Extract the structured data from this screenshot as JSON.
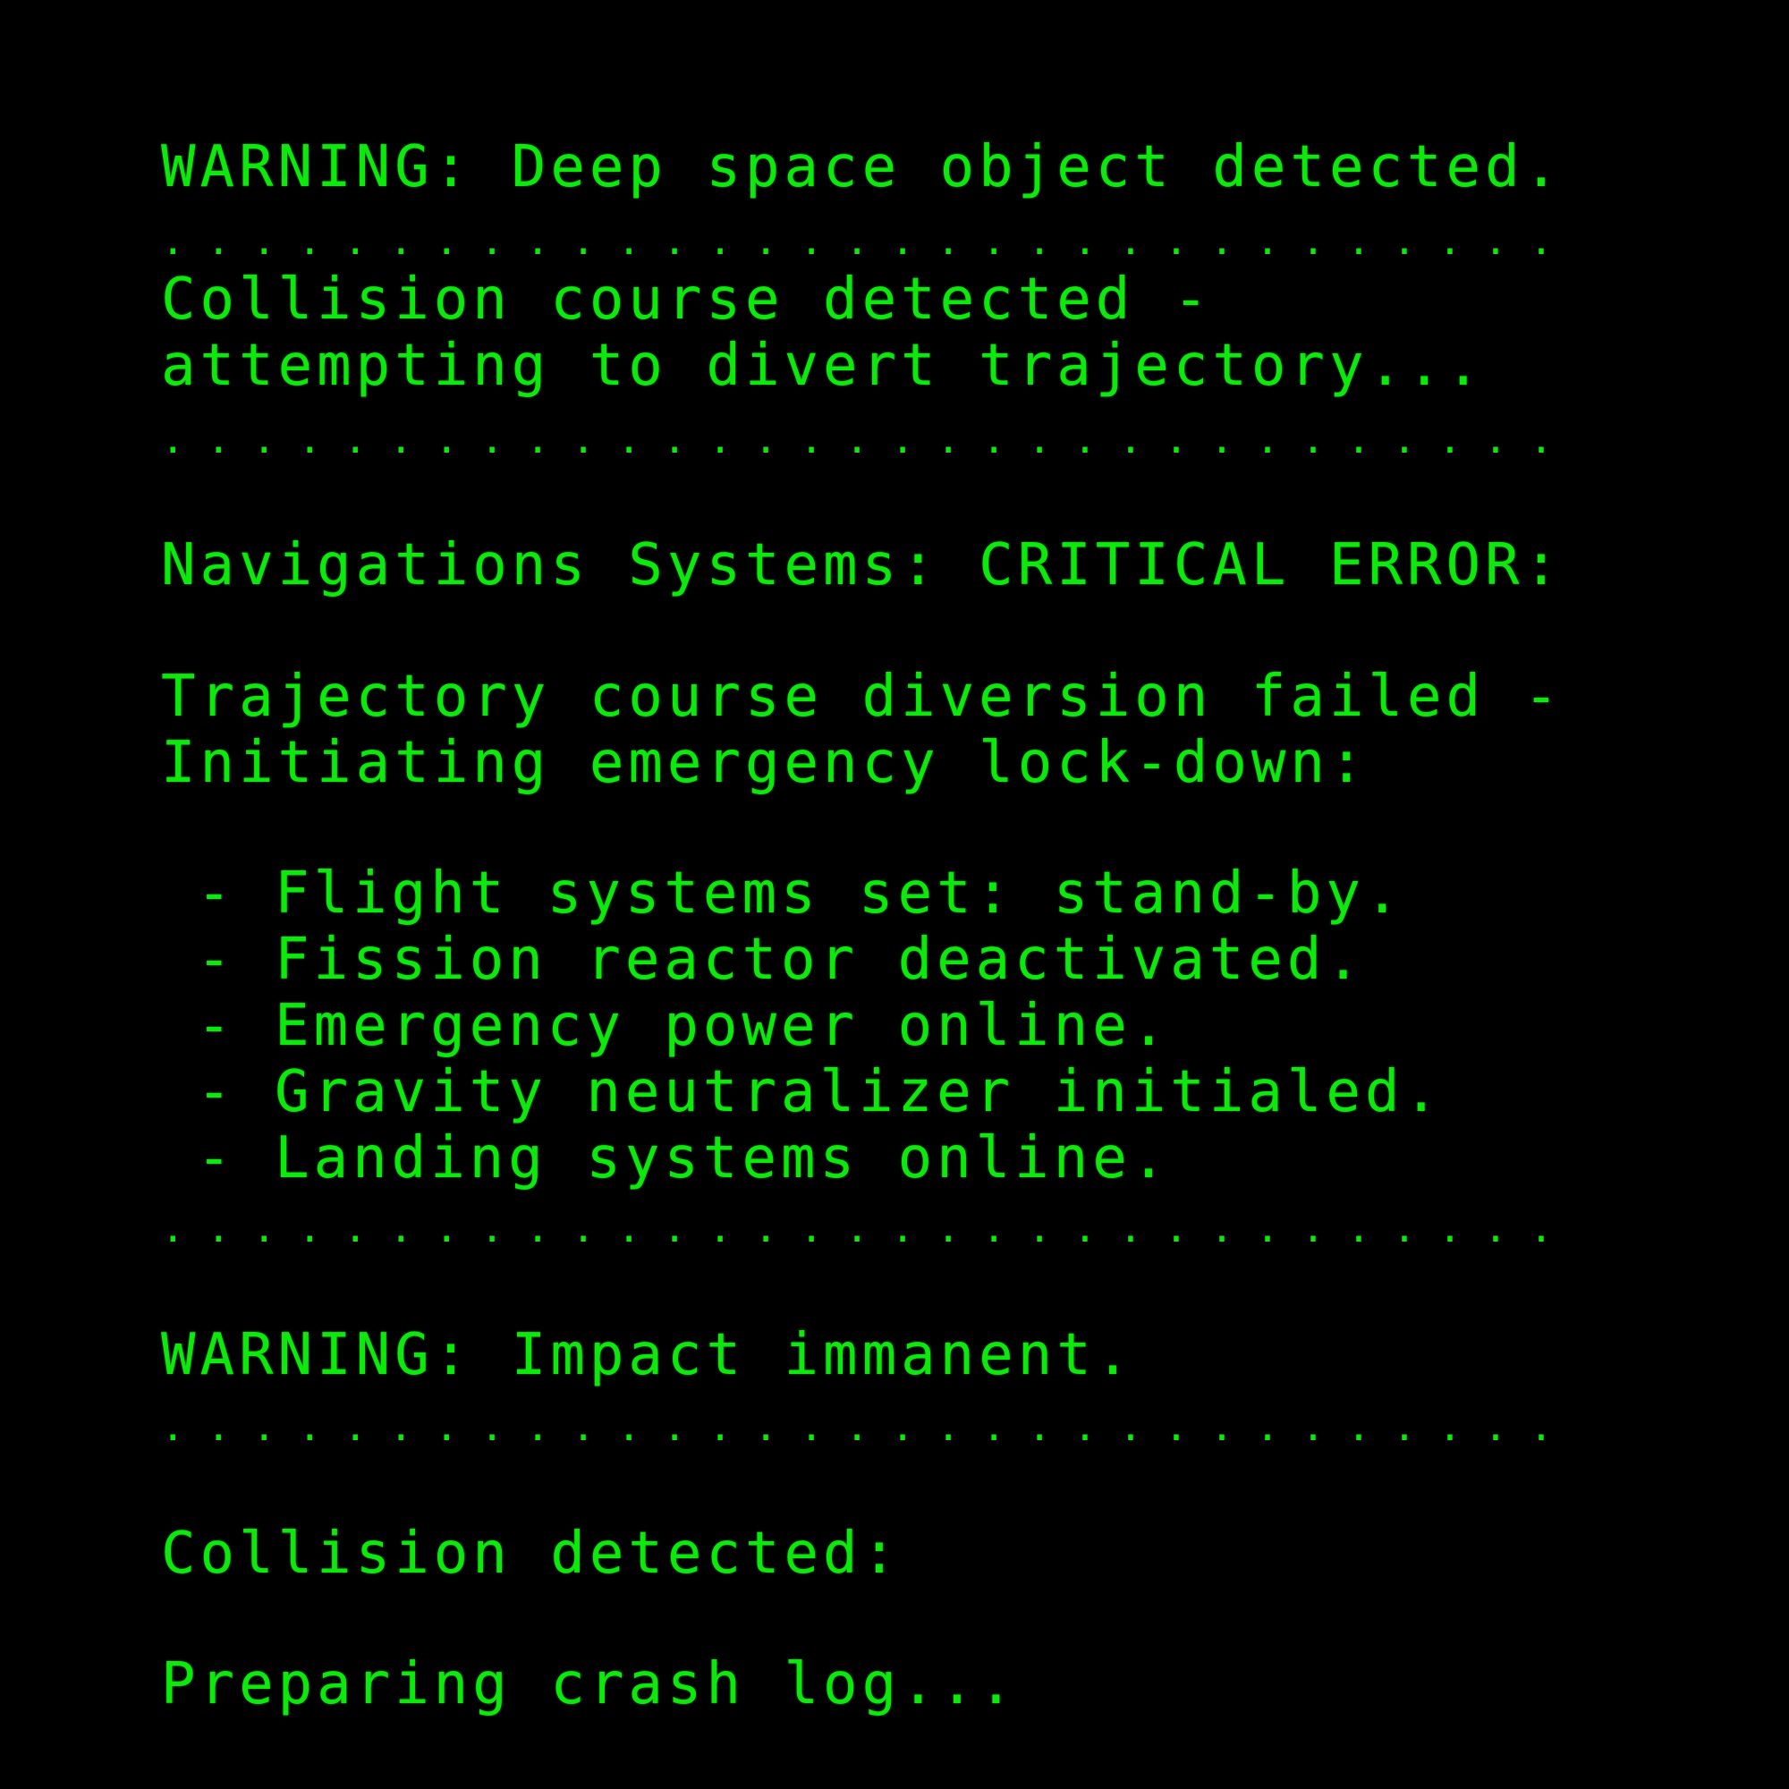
{
  "theme": {
    "background": "#000000",
    "text_color": "#0de80d"
  },
  "terminal": {
    "line1": "WARNING: Deep space object detected.",
    "sep1": "........................................",
    "line2": "Collision course detected -",
    "line3": "attempting to divert trajectory...",
    "sep2": "........................................",
    "line4": "Navigations Systems: CRITICAL ERROR:",
    "line5": "Trajectory course diversion failed -",
    "line6": "Initiating emergency lock-down:",
    "items": [
      "- Flight systems set: stand-by.",
      "- Fission reactor deactivated.",
      "- Emergency power online.",
      "- Gravity neutralizer initialed.",
      "- Landing systems online."
    ],
    "sep3": "........................................",
    "line7": "WARNING: Impact immanent.",
    "sep4": "........................................",
    "line8": "Collision detected:",
    "line9": "Preparing crash log..."
  }
}
